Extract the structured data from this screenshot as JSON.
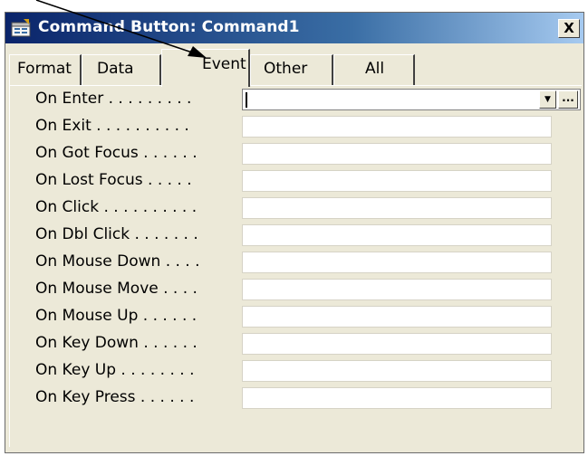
{
  "window": {
    "title": "Command Button: Command1",
    "close_label": "X"
  },
  "tabs": [
    {
      "label": "Format",
      "active": false
    },
    {
      "label": "Data",
      "active": false
    },
    {
      "label": "Event",
      "active": true
    },
    {
      "label": "Other",
      "active": false
    },
    {
      "label": "All",
      "active": false
    }
  ],
  "properties": [
    {
      "label": "On Enter . . . . . . . . . ",
      "value": ""
    },
    {
      "label": "On Exit . . . . . . . . . . ",
      "value": ""
    },
    {
      "label": "On Got Focus . . . . . . ",
      "value": ""
    },
    {
      "label": "On Lost Focus . . . . . ",
      "value": ""
    },
    {
      "label": "On Click . . . . . . . . . . ",
      "value": ""
    },
    {
      "label": "On Dbl Click . . . . . . . ",
      "value": ""
    },
    {
      "label": "On Mouse Down . . . . ",
      "value": ""
    },
    {
      "label": "On Mouse Move . . . . ",
      "value": ""
    },
    {
      "label": "On Mouse Up . . . . . . ",
      "value": ""
    },
    {
      "label": "On Key Down . . . . . . ",
      "value": ""
    },
    {
      "label": "On Key Up . . . . . . . . ",
      "value": ""
    },
    {
      "label": "On Key Press . . . . . . ",
      "value": ""
    }
  ],
  "field_buttons": {
    "dropdown_glyph": "▼",
    "build_glyph": "..."
  }
}
